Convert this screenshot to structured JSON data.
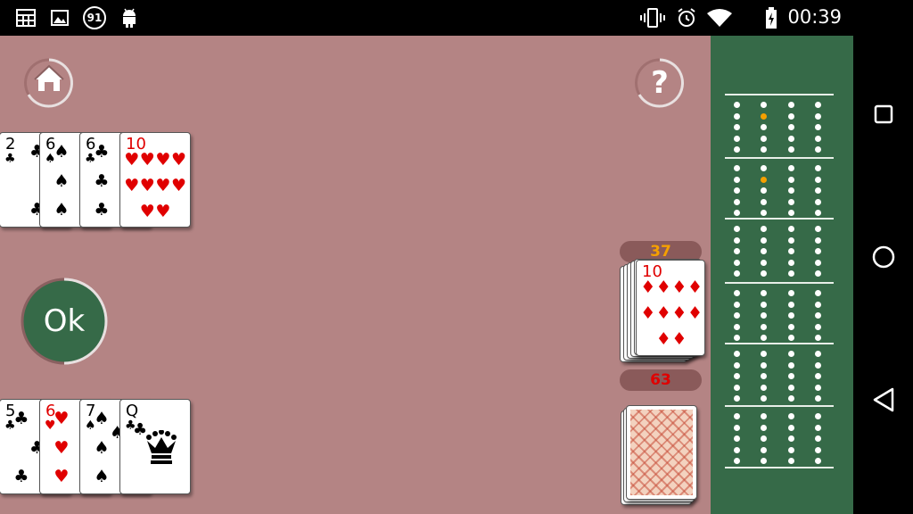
{
  "status_bar": {
    "time": "00:39",
    "notification_badge": "91",
    "icons": [
      "calendar-grid-icon",
      "image-icon",
      "badge-91-icon",
      "android-icon",
      "vibrate-icon",
      "alarm-icon",
      "wifi-icon",
      "battery-charging-icon"
    ]
  },
  "table": {
    "home_button": "home-icon",
    "help_button": "help-icon",
    "help_glyph": "?",
    "ok_button_label": "Ok",
    "colors": {
      "felt": "#b48484",
      "ok_button": "#366a48",
      "board": "#366a48"
    }
  },
  "opponent_hand": [
    {
      "rank": "2",
      "suit": "♣",
      "color": "black"
    },
    {
      "rank": "6",
      "suit": "♠",
      "color": "black"
    },
    {
      "rank": "6",
      "suit": "♣",
      "color": "black"
    },
    {
      "rank": "10",
      "suit": "♥",
      "color": "red"
    }
  ],
  "player_hand": [
    {
      "rank": "5",
      "suit": "♣",
      "color": "black"
    },
    {
      "rank": "6",
      "suit": "♥",
      "color": "red"
    },
    {
      "rank": "7",
      "suit": "♠",
      "color": "black"
    },
    {
      "rank": "Q",
      "suit": "♣",
      "color": "black"
    }
  ],
  "pile": {
    "top_score": "37",
    "top_score_color": "#f5a000",
    "top_card": {
      "rank": "10",
      "suit": "♦",
      "color": "red"
    },
    "bottom_score": "63",
    "bottom_score_color": "#e00000"
  },
  "navigation": {
    "recents": "square-icon",
    "home": "circle-icon",
    "back": "triangle-back-icon"
  }
}
